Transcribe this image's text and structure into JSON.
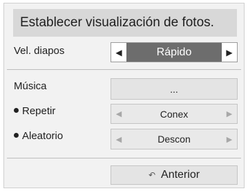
{
  "dialog": {
    "title": "Establecer visualización de fotos."
  },
  "slide_speed": {
    "label": "Vel. diapos",
    "value": "Rápido",
    "left_icon": "arrow-left-icon",
    "right_icon": "arrow-right-icon"
  },
  "music": {
    "label": "Música",
    "button_label": "...",
    "repeat": {
      "label": "Repetir",
      "value": "Conex"
    },
    "shuffle": {
      "label": "Aleatorio",
      "value": "Descon"
    }
  },
  "footer": {
    "back_label": "Anterior",
    "back_icon": "return-arrow-icon"
  },
  "colors": {
    "highlight": "#6d6d6d",
    "title_bar": "#d8d8d8",
    "background": "#f2f2f2"
  }
}
